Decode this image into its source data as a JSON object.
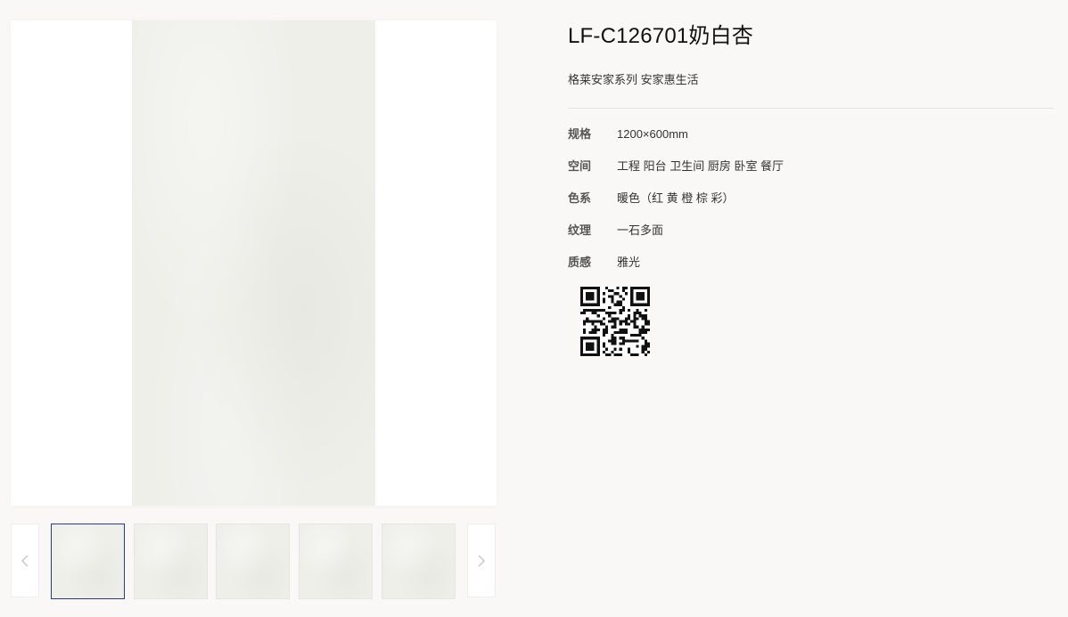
{
  "product": {
    "title": "LF-C126701奶白杏",
    "subtitle": "格莱安家系列 安家惠生活",
    "specs": [
      {
        "label": "规格",
        "value": "1200×600mm"
      },
      {
        "label": "空间",
        "value": "工程 阳台 卫生间 厨房 卧室 餐厅"
      },
      {
        "label": "色系",
        "value": "暖色（红 黄 橙 棕 彩）"
      },
      {
        "label": "纹理",
        "value": "一石多面"
      },
      {
        "label": "质感",
        "value": "雅光"
      }
    ]
  },
  "gallery": {
    "thumbnail_count": 5,
    "active_index": 0,
    "tile_color": "#efefea",
    "active_border_color": "#2b3a8f"
  },
  "icons": {
    "prev": "chevron-left-icon",
    "next": "chevron-right-icon",
    "qr": "qr-code-icon"
  }
}
